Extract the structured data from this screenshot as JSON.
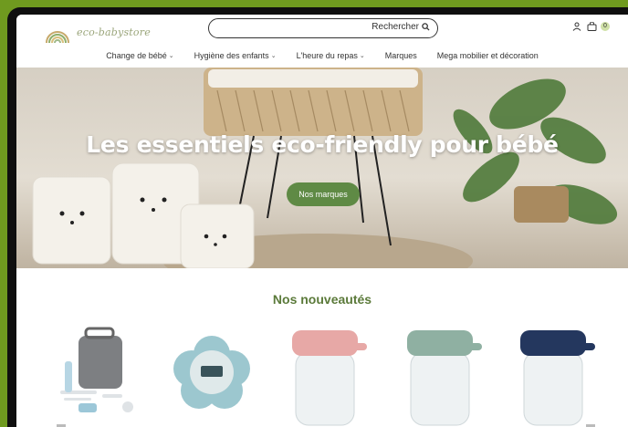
{
  "brand": {
    "name": "eco-babystore"
  },
  "search": {
    "placeholder": "",
    "button_label": "Rechercher"
  },
  "cart": {
    "count": "0"
  },
  "nav": {
    "items": [
      {
        "label": "Change de bébé",
        "has_dropdown": true
      },
      {
        "label": "Hygiène des enfants",
        "has_dropdown": true
      },
      {
        "label": "L'heure du repas",
        "has_dropdown": true
      },
      {
        "label": "Marques",
        "has_dropdown": false
      },
      {
        "label": "Mega mobilier et décoration",
        "has_dropdown": false
      }
    ]
  },
  "hero": {
    "title": "Les essentiels eco-friendly pour bébé",
    "button_label": "Nos marques"
  },
  "new_products": {
    "title": "Nos nouveautés",
    "items": [
      {
        "icon": "toiletry-kit-icon"
      },
      {
        "icon": "bath-thermometer-icon",
        "color": "#9cc7cf"
      },
      {
        "icon": "food-jar-pink-icon",
        "color": "#e7a8a6"
      },
      {
        "icon": "food-jar-sage-icon",
        "color": "#8fb0a2"
      },
      {
        "icon": "food-jar-navy-icon",
        "color": "#24375e"
      }
    ]
  },
  "colors": {
    "accent": "#5f8a45",
    "title_green": "#5b7a3a",
    "border": "#6f9a1f"
  }
}
